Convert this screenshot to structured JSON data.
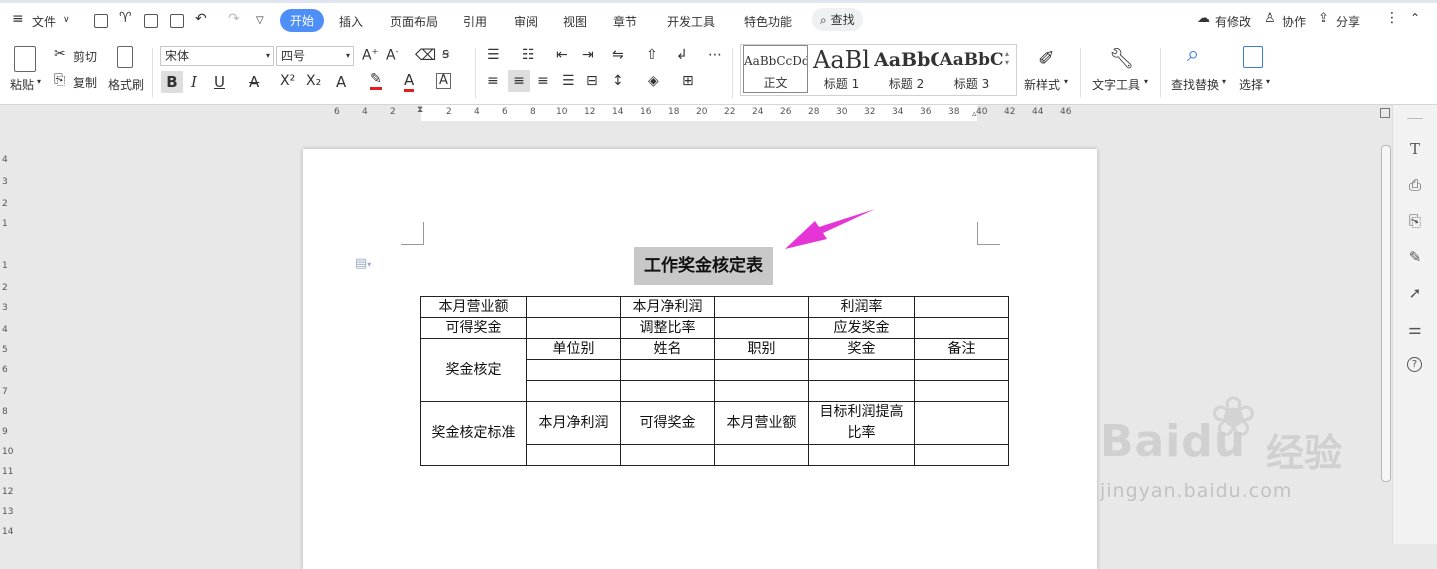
{
  "menubar": {
    "file_label": "文件",
    "tabs": [
      "开始",
      "插入",
      "页面布局",
      "引用",
      "审阅",
      "视图",
      "章节",
      "开发工具",
      "特色功能"
    ],
    "search_label": "查找",
    "right": {
      "changes": "有修改",
      "collab": "协作",
      "share": "分享"
    },
    "accent_color": "#4e8ef7"
  },
  "toolbar": {
    "paste": "粘贴",
    "cut": "剪切",
    "copy": "复制",
    "format_painter": "格式刷",
    "font_name": "宋体",
    "font_size": "四号",
    "bold": "B",
    "italic": "I",
    "underline": "U",
    "strikethrough": "A",
    "superscript": "X²",
    "subscript": "X₂",
    "text_effect": "A",
    "font_color": "A",
    "char_border": "A",
    "styles": [
      {
        "sample": "AaBbCcDd",
        "label": "正文"
      },
      {
        "sample": "AaBl",
        "label": "标题 1"
      },
      {
        "sample": "AaBbC",
        "label": "标题 2"
      },
      {
        "sample": "AaBbC",
        "label": "标题 3"
      }
    ],
    "new_style": "新样式",
    "text_tools": "文字工具",
    "find_replace": "查找替换",
    "select": "选择"
  },
  "ruler": {
    "h_ticks": [
      "6",
      "4",
      "2",
      "2",
      "4",
      "6",
      "8",
      "10",
      "12",
      "14",
      "16",
      "18",
      "20",
      "22",
      "24",
      "26",
      "28",
      "30",
      "32",
      "34",
      "36",
      "38",
      "40",
      "42",
      "44",
      "46"
    ],
    "v_ticks": [
      "4",
      "3",
      "2",
      "1",
      "1",
      "2",
      "3",
      "4",
      "5",
      "6",
      "7",
      "8",
      "9",
      "10",
      "11",
      "12",
      "13",
      "14"
    ]
  },
  "document": {
    "title": "工作奖金核定表",
    "table": {
      "row1": [
        "本月营业额",
        "",
        "本月净利润",
        "",
        "利润率",
        ""
      ],
      "row2": [
        "可得奖金",
        "",
        "调整比率",
        "",
        "应发奖金",
        ""
      ],
      "row3_label": "奖金核定",
      "row3": [
        "单位别",
        "姓名",
        "职别",
        "奖金",
        "备注"
      ],
      "row6_label": "奖金核定标准",
      "row6": [
        "本月净利润",
        "可得奖金",
        "本月营业额",
        "目标利润提高比率",
        ""
      ]
    }
  },
  "watermark": {
    "brand": "Baidu",
    "cn": "经验",
    "url": "jingyan.baidu.com"
  },
  "annotation_arrow_color": "#e535d6"
}
